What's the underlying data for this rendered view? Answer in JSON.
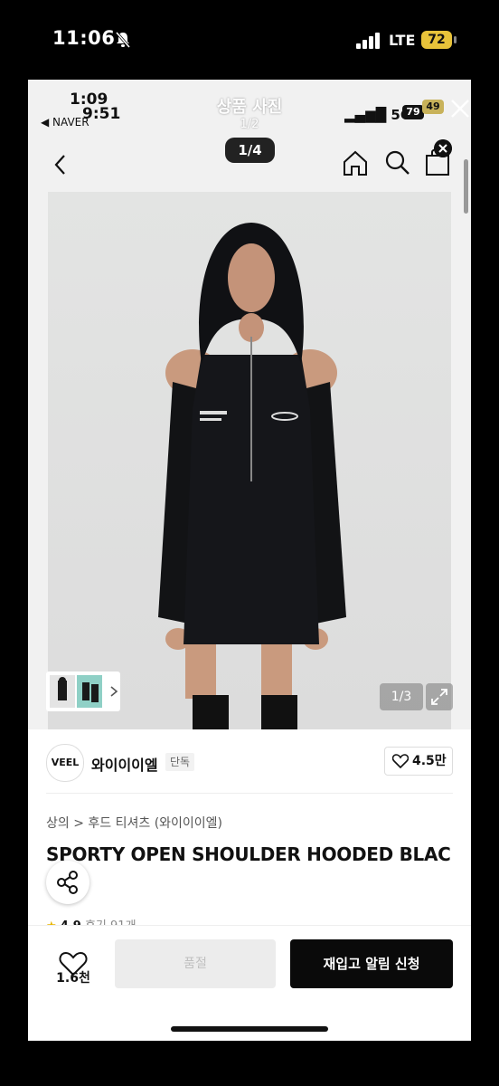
{
  "status_bar": {
    "time": "11:06",
    "network": "LTE",
    "battery": "72",
    "battery_color": "#e8c33a"
  },
  "inner_status": {
    "time_a": "1:09",
    "time_b": "9:51",
    "back_app": "◀ NAVER",
    "network": "5G",
    "battery_a": "79",
    "battery_b": "49"
  },
  "viewer": {
    "title": "상품 사진",
    "count": "1/2"
  },
  "product_header": {
    "page_indicator": "1/4"
  },
  "gallery": {
    "counter": "1/3"
  },
  "brand": {
    "logo_text": "VEEL",
    "name": "와이이이엘",
    "tag": "단독",
    "likes": "4.5만"
  },
  "breadcrumb": "상의 > 후드 티셔츠 (와이이이엘)",
  "product": {
    "title": "SPORTY OPEN SHOULDER HOODED BLAC",
    "rating": "4.9",
    "reviews": "후기 91개"
  },
  "actions": {
    "wish_count": "1.6천",
    "soldout_label": "품절",
    "restock_label": "재입고 알림 신청"
  },
  "colors": {
    "accent": "#0a0a0a",
    "rating_star": "#e8b600"
  }
}
